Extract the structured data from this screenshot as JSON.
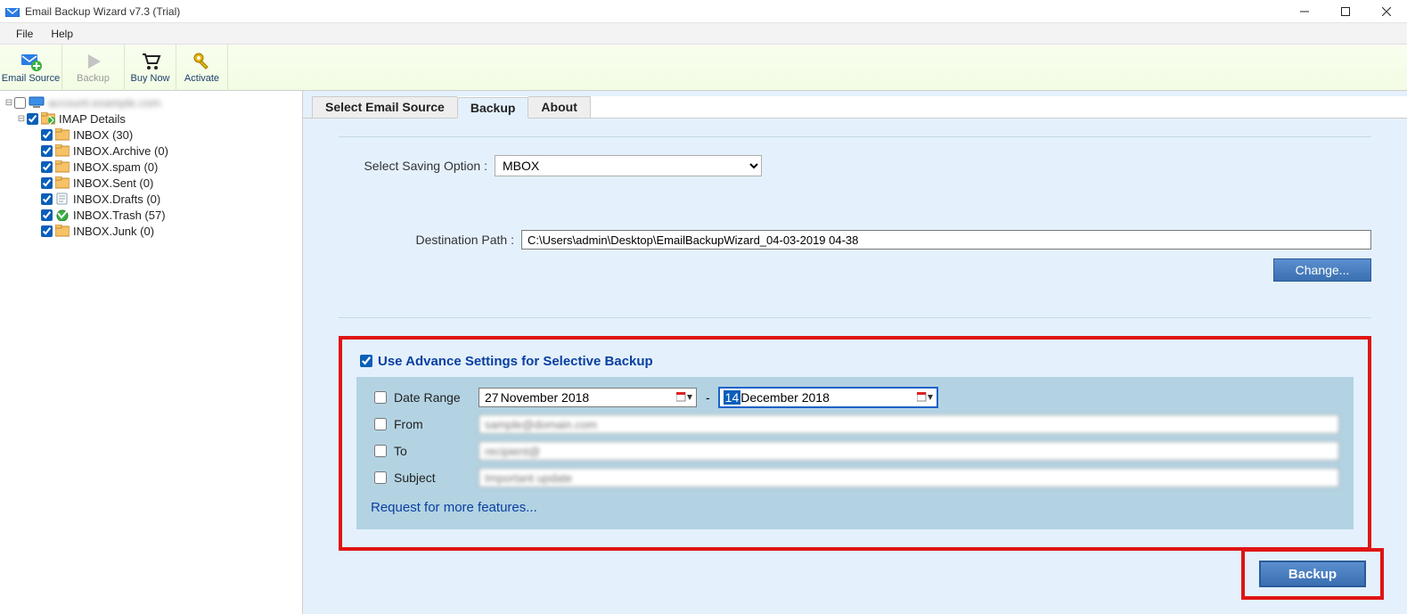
{
  "window": {
    "title": "Email Backup Wizard v7.3 (Trial)"
  },
  "menu": {
    "file": "File",
    "help": "Help"
  },
  "toolbar": {
    "email_source": "Email Source",
    "backup": "Backup",
    "buy_now": "Buy Now",
    "activate": "Activate"
  },
  "tree": {
    "root": "",
    "imap_details": "IMAP Details",
    "items": [
      {
        "label": "INBOX (30)"
      },
      {
        "label": "INBOX.Archive (0)"
      },
      {
        "label": "INBOX.spam (0)"
      },
      {
        "label": "INBOX.Sent (0)"
      },
      {
        "label": "INBOX.Drafts (0)"
      },
      {
        "label": "INBOX.Trash (57)"
      },
      {
        "label": "INBOX.Junk (0)"
      }
    ]
  },
  "tabs": {
    "select_email_source": "Select Email Source",
    "backup": "Backup",
    "about": "About"
  },
  "form": {
    "saving_option_label": "Select Saving Option  :",
    "saving_option_value": "MBOX",
    "destination_label": "Destination Path  :",
    "destination_value": "C:\\Users\\admin\\Desktop\\EmailBackupWizard_04-03-2019 04-38",
    "change_btn": "Change..."
  },
  "advanced": {
    "title": "Use Advance Settings for Selective Backup",
    "date_range": "Date Range",
    "date_from_day": "27",
    "date_from_rest": "  November  2018",
    "date_to_day": "14",
    "date_to_rest": "  December  2018",
    "from": "From",
    "to": "To",
    "subject": "Subject",
    "request_link": "Request for more features..."
  },
  "footer": {
    "backup": "Backup"
  }
}
